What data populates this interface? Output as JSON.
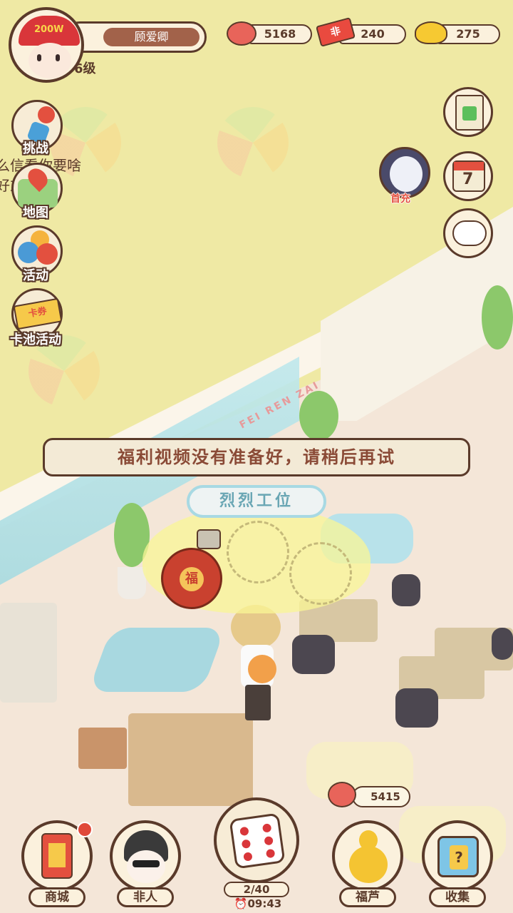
{
  "player": {
    "name": "顾爱卿",
    "level": "6级",
    "hat_text": "200W"
  },
  "currencies": [
    {
      "name": "cloud-coin-icon",
      "value": "5168"
    },
    {
      "name": "ticket-icon",
      "icon_text": "非",
      "value": "240"
    },
    {
      "name": "gold-ingot-icon",
      "value": "275"
    }
  ],
  "left_menu": [
    {
      "label": "挑战"
    },
    {
      "label": "地图"
    },
    {
      "label": "活动"
    },
    {
      "label": "卡池活动",
      "icon_text": "卡券"
    }
  ],
  "scroll_text": {
    "line1": "么信看你要啥",
    "line2": "好友"
  },
  "right_menu": {
    "first_charge_label": "首充",
    "calendar_day": "7"
  },
  "toast": {
    "message": "福利视频没有准备好，请稍后再试"
  },
  "station": {
    "label": "烈烈工位",
    "bag_text": "福"
  },
  "scene_text": {
    "window_sign": "FEI REN ZAI"
  },
  "income_bubble": {
    "value": "5415"
  },
  "bottom_bar": {
    "shop": "商城",
    "feiren": "非人",
    "dice_count": "2/40",
    "timer": "09:43",
    "gourd": "福芦",
    "collect": "收集"
  },
  "colors": {
    "background": "#efe9a4",
    "outline": "#5a3a2a",
    "toast_text": "#8a4a36",
    "station_text": "#6aa6b4",
    "notification_dot": "#e0493a"
  }
}
